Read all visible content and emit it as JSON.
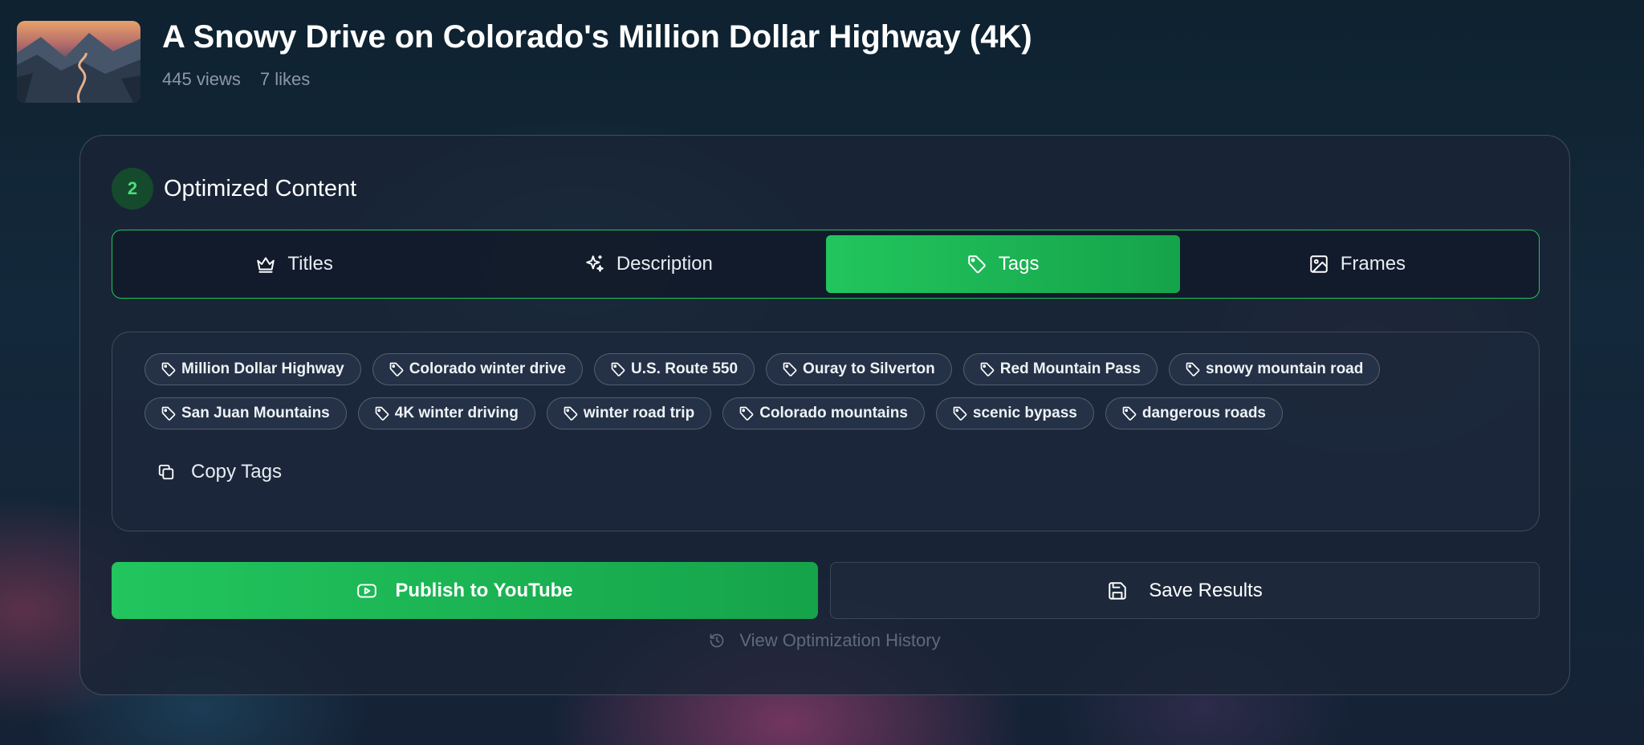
{
  "video": {
    "title": "A Snowy Drive on Colorado's Million Dollar Highway (4K)",
    "views": "445 views",
    "likes": "7 likes"
  },
  "section": {
    "step": "2",
    "title": "Optimized Content"
  },
  "tabs": [
    {
      "label": "Titles",
      "icon": "crown-icon",
      "active": false
    },
    {
      "label": "Description",
      "icon": "sparkles-icon",
      "active": false
    },
    {
      "label": "Tags",
      "icon": "tag-icon",
      "active": true
    },
    {
      "label": "Frames",
      "icon": "image-icon",
      "active": false
    }
  ],
  "tags": {
    "row1": [
      "Million Dollar Highway",
      "Colorado winter drive",
      "U.S. Route 550",
      "Ouray to Silverton",
      "Red Mountain Pass",
      "snowy mountain road"
    ],
    "row2": [
      "San Juan Mountains",
      "4K winter driving",
      "winter road trip",
      "Colorado mountains",
      "scenic bypass",
      "dangerous roads"
    ],
    "copy_label": "Copy Tags"
  },
  "actions": {
    "publish_label": "Publish to YouTube",
    "save_label": "Save Results",
    "history_label": "View Optimization History"
  },
  "colors": {
    "accent": "#22c55e",
    "accent_dark": "#16a34a",
    "card_bg": "#1a2436",
    "muted_text": "#8d97a8"
  }
}
